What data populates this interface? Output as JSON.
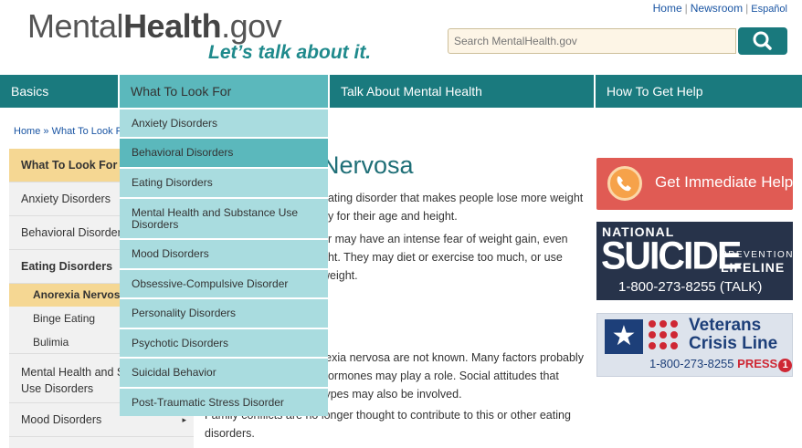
{
  "header": {
    "logo_part1": "Mental",
    "logo_part2": "Health",
    "logo_part3": ".gov",
    "tagline": "Let’s talk about it.",
    "links": {
      "home": "Home",
      "sep1": "|",
      "newsroom": "Newsroom",
      "sep2": "|",
      "espanol": "Español"
    },
    "search_placeholder": "Search MentalHealth.gov",
    "search_icon": "search-icon"
  },
  "nav": {
    "basics": "Basics",
    "what": "What To Look For",
    "talk": "Talk About Mental Health",
    "help": "How To Get Help"
  },
  "breadcrumb": "Home » What To Look Fo",
  "sidebar": {
    "header": "What To Look For",
    "anxiety": "Anxiety Disorders",
    "behavioral": "Behavioral Disorders",
    "eating": "Eating Disorders",
    "anorexia": "Anorexia Nervosa",
    "binge": "Binge Eating",
    "bulimia": "Bulimia",
    "mhsud_line1": "Mental Health and Substance",
    "mhsud_line2": "Use Disorders",
    "mood": "Mood Disorders",
    "mood_chevron": "▸"
  },
  "dropdown": [
    "Anxiety Disorders",
    "Behavioral Disorders",
    "Eating Disorders",
    "Mental Health and Substance Use Disorders",
    "Mood Disorders",
    "Obsessive-Compulsive Disorder",
    "Personality Disorders",
    "Psychotic Disorders",
    "Suicidal Behavior",
    "Post-Traumatic Stress Disorder"
  ],
  "content": {
    "title": "Nervosa",
    "p1_line1": "eating disorder that makes people lose more weight",
    "p1_line2": "hy for their age and height.",
    "p2_line1": "er may have an intense fear of weight gain, even",
    "p2_line2": "ght. They may diet or exercise too much, or use",
    "p2_line3": "weight.",
    "p3_line1": "rexia nervosa are not known. Many factors probably",
    "p3_line2": "hormones may play a role. Social attitudes that",
    "p3_line3": "types may also be involved.",
    "p4_line1": "Family conflicts are no longer thought to contribute to this or other eating",
    "p4_line2": "disorders."
  },
  "right": {
    "immediate_help": "Get Immediate Help",
    "lifeline_national": "NATIONAL",
    "lifeline_suicide": "SUICIDE",
    "lifeline_prevention": "PREVENTION",
    "lifeline_lifeline": "LIFELINE",
    "lifeline_phone": "1-800-273-8255 (TALK)",
    "veterans_line1": "Veterans",
    "veterans_line2": "Crisis Line",
    "veterans_phone": "1-800-273-8255",
    "veterans_press": "PRESS",
    "veterans_press_num": "1"
  },
  "colors": {
    "nav_teal": "#1a7a7e",
    "dropdown_bg": "#a9dcdf",
    "dropdown_active": "#5bb8bc",
    "sidebar_highlight": "#f5d793",
    "help_red": "#e05b54",
    "lifeline_navy": "#27334a",
    "veterans_blue": "#1d3f79"
  }
}
